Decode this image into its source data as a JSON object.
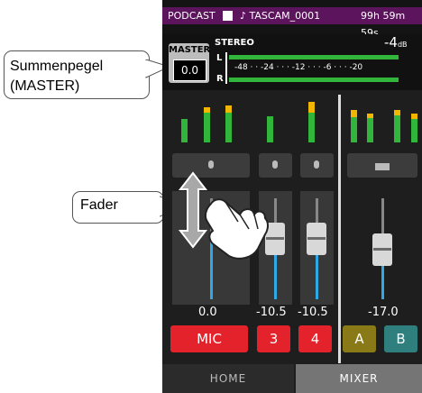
{
  "status": {
    "mode": "PODCAST",
    "file": "♪ TASCAM_0001",
    "time": "99h 59m 59s"
  },
  "master": {
    "label": "MASTER",
    "value": "0.0",
    "mode": "STEREO",
    "peak": "-4",
    "peak_unit": "dB",
    "left": "L",
    "right": "R",
    "scale": "-48 · · -24 · · · -12 · · · -6 · · · -20",
    "level_left": 0.93,
    "level_right": 0.93
  },
  "channels": [
    {
      "label": "MIC",
      "value": "0.0",
      "color": "#e4222b"
    },
    {
      "label": "3",
      "value": "-10.5",
      "color": "#e4222b"
    },
    {
      "label": "4",
      "value": "-10.5",
      "color": "#e4222b"
    },
    {
      "label": "A",
      "value": "-17.0",
      "color": "#8a7a17"
    },
    {
      "label": "B",
      "value": "",
      "color": "#2f7f7f"
    }
  ],
  "tabs": {
    "home": "HOME",
    "mixer": "MIXER"
  },
  "callouts": {
    "master": "Summenpegel\n(MASTER)",
    "fader": "Fader"
  },
  "colors": {
    "status_bar": "#5c145c",
    "meter_green": "#31b53a",
    "meter_yellow": "#f2b600",
    "fader_blue": "#31a8e6"
  }
}
